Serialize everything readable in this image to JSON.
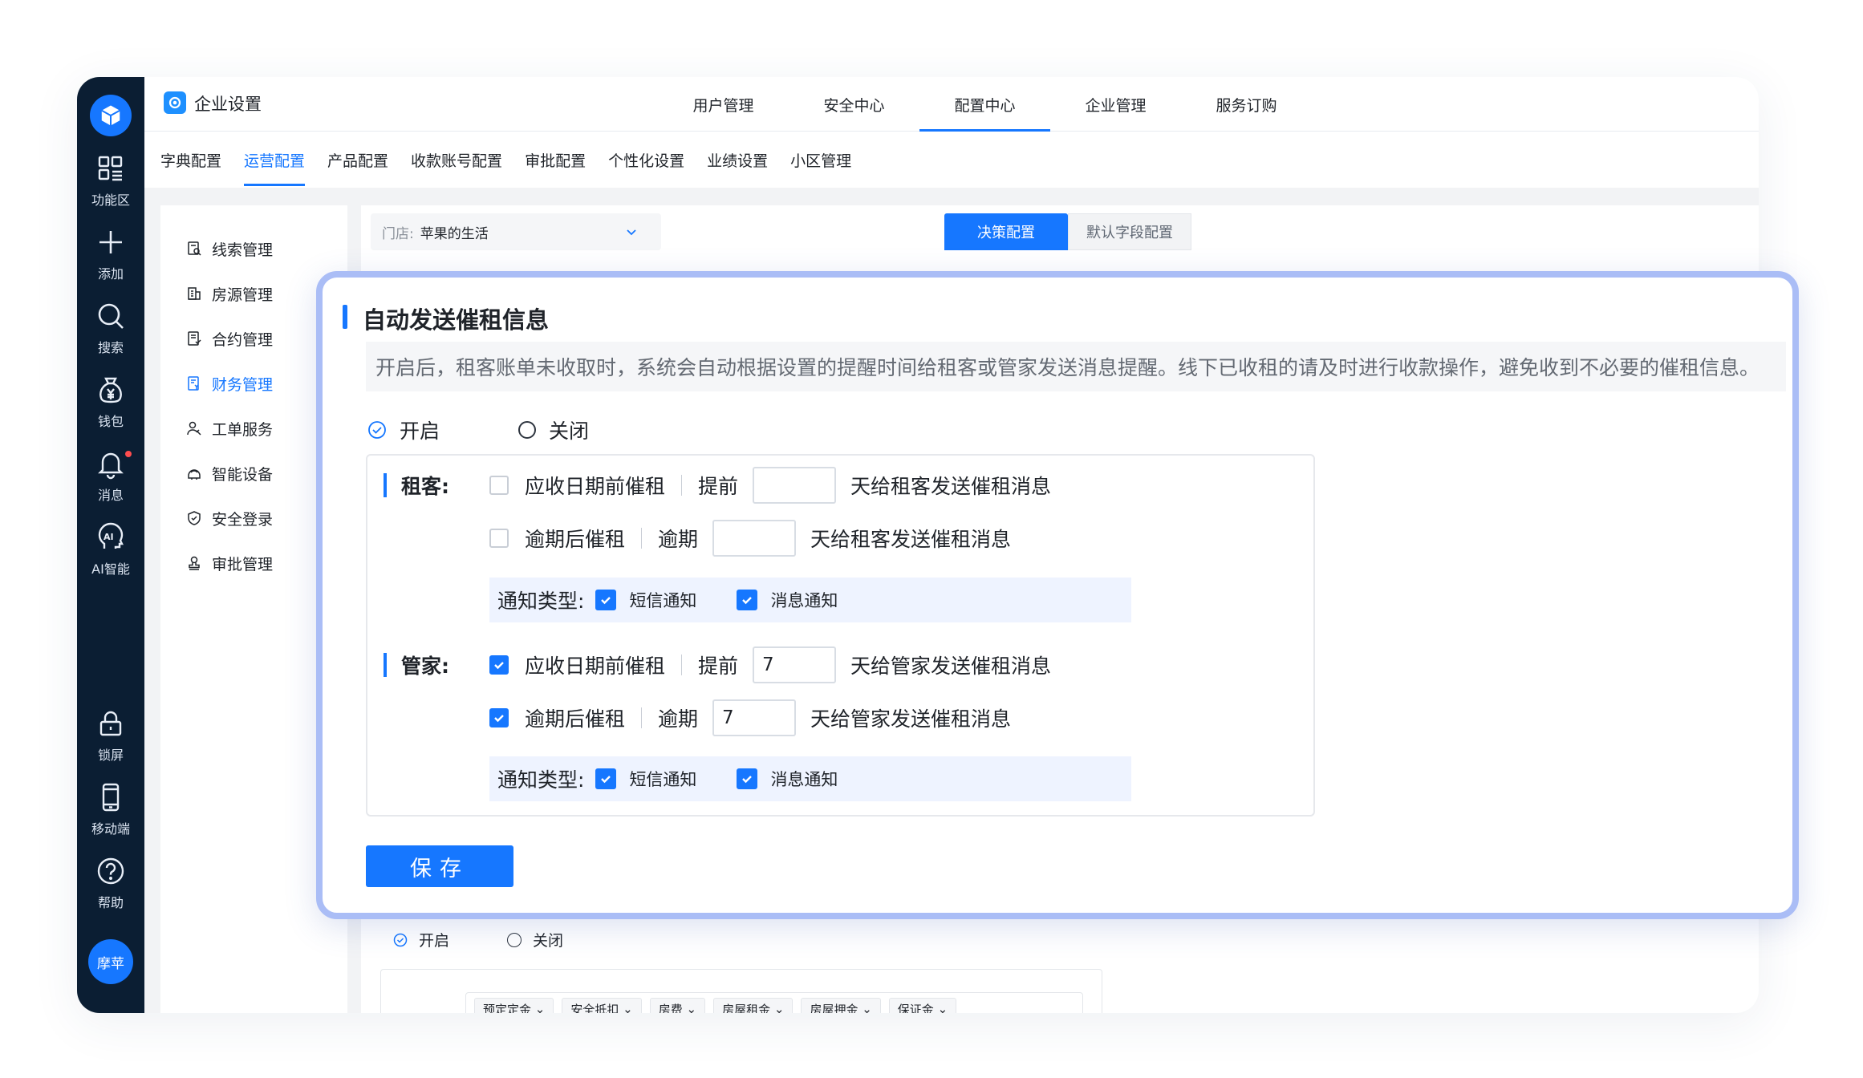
{
  "sidebar": {
    "items": [
      {
        "label": "功能区",
        "icon": "grid-icon"
      },
      {
        "label": "添加",
        "icon": "plus-icon"
      },
      {
        "label": "搜索",
        "icon": "search-icon"
      },
      {
        "label": "钱包",
        "icon": "wallet-icon"
      },
      {
        "label": "消息",
        "icon": "bell-icon"
      },
      {
        "label": "AI智能",
        "icon": "ai-icon"
      },
      {
        "label": "锁屏",
        "icon": "lock-icon"
      },
      {
        "label": "移动端",
        "icon": "mobile-icon"
      },
      {
        "label": "帮助",
        "icon": "help-icon"
      }
    ],
    "avatar": "摩苹"
  },
  "header": {
    "title": "企业设置",
    "nav": [
      "用户管理",
      "安全中心",
      "配置中心",
      "企业管理",
      "服务订购"
    ],
    "active_nav": "配置中心"
  },
  "subnav": {
    "items": [
      "字典配置",
      "运营配置",
      "产品配置",
      "收款账号配置",
      "审批配置",
      "个性化设置",
      "业绩设置",
      "小区管理"
    ],
    "active": "运营配置"
  },
  "left_menu": {
    "items": [
      "线索管理",
      "房源管理",
      "合约管理",
      "财务管理",
      "工单服务",
      "智能设备",
      "安全登录",
      "审批管理"
    ],
    "active": "财务管理"
  },
  "content": {
    "store_label": "门店:",
    "store_value": "苹果的生活",
    "tab_primary": "决策配置",
    "tab_secondary": "默认字段配置",
    "bottom_on": "开启",
    "bottom_off": "关闭",
    "chips": [
      "预定定金",
      "安全抵扣",
      "房费",
      "房屋租金",
      "房屋押金",
      "保证金"
    ]
  },
  "modal": {
    "title": "自动发送催租信息",
    "description": "开启后，租客账单未收取时，系统会自动根据设置的提醒时间给租客或管家发送消息提醒。线下已收租的请及时进行收款操作，避免收到不必要的催租信息。",
    "radio_on": "开启",
    "radio_off": "关闭",
    "tenant": {
      "label": "租客:",
      "due_label": "应收日期前催租",
      "due_pre": "提前",
      "due_value": "",
      "due_post": "天给租客发送催租消息",
      "overdue_label": "逾期后催租",
      "overdue_pre": "逾期",
      "overdue_value": "",
      "overdue_post": "天给租客发送催租消息",
      "notify_label": "通知类型:",
      "sms": "短信通知",
      "msg": "消息通知"
    },
    "housekeeper": {
      "label": "管家:",
      "due_label": "应收日期前催租",
      "due_pre": "提前",
      "due_value": "7",
      "due_post": "天给管家发送催租消息",
      "overdue_label": "逾期后催租",
      "overdue_pre": "逾期",
      "overdue_value": "7",
      "overdue_post": "天给管家发送催租消息",
      "notify_label": "通知类型:",
      "sms": "短信通知",
      "msg": "消息通知"
    },
    "save": "保存"
  },
  "colors": {
    "accent": "#1677ff",
    "sidebar": "#0b1e33",
    "modal_border": "#aabdf6"
  }
}
